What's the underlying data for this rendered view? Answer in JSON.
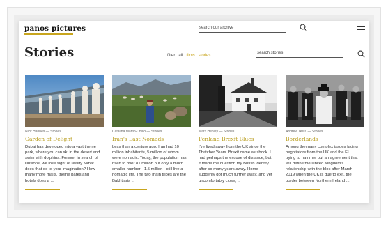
{
  "header": {
    "logo_text": "panos pictures",
    "archive_search_placeholder": "search our archive"
  },
  "stories_section": {
    "title": "Stories",
    "filter_label": "filter",
    "filters": [
      {
        "label": "all",
        "active": false
      },
      {
        "label": "films",
        "active": true
      },
      {
        "label": "stories",
        "active": true
      }
    ],
    "search_placeholder": "search stories"
  },
  "cards": [
    {
      "author": "Nick Hannes",
      "category": "Stories",
      "title": "Garden of Delight",
      "excerpt_lines": [
        "Dubai has developed into a vast theme",
        "park, where you can ski in the desert and",
        "swim with dolphins. Forever in search of",
        "illusions, we lose sight of reality. What",
        "does that do to your imagination? How",
        "many more malls, theme parks and",
        "hotels does a ..."
      ]
    },
    {
      "author": "Catalina Martin-Chico",
      "category": "Stories",
      "title": "Iran's Last Nomads",
      "excerpt_lines": [
        "Less than a century ago, Iran had 10",
        "million inhabitants, 5 million of whom",
        "were nomadic. Today, the population has",
        "risen to over 81 million but only a much",
        "smaller number - 1.5 million - still live a",
        "nomadic life. The two main tribes are the",
        "Bakhtiaris ..."
      ]
    },
    {
      "author": "Mark Henley",
      "category": "Stories",
      "title": "Fenland Brexit Blues",
      "excerpt_lines": [
        "I've lived away from the UK since the",
        "Thatcher Years. Brexit came as shock. I",
        "had perhaps the excuse of distance, but",
        "it made me question my British identity",
        "after so many years away. Home",
        "suddenly got much further away, and yet",
        "uncomfortably close, ..."
      ]
    },
    {
      "author": "Andrew Testa",
      "category": "Stories",
      "title": "Borderlands",
      "excerpt_lines": [
        "Among the many complex issues facing",
        "negotiators from the UK and the EU",
        "trying to hammer out an agreement that",
        "will define the United Kingdom's",
        "relationship with the bloc after March",
        "2019 when the UK is due to exit, the",
        "border between Northern Ireland ..."
      ]
    }
  ],
  "colors": {
    "accent": "#c8a51d",
    "title_link": "#b99d1e",
    "text": "#333333"
  },
  "icons": [
    "search-icon",
    "menu-icon"
  ]
}
